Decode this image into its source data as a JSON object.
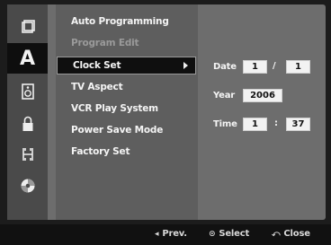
{
  "sidebar": {
    "icons": [
      {
        "name": "disc-setup-icon",
        "active": false
      },
      {
        "name": "language-icon",
        "letter": "A",
        "active": true
      },
      {
        "name": "speaker-icon",
        "active": false
      },
      {
        "name": "lock-icon",
        "active": false
      },
      {
        "name": "recording-icon",
        "active": false
      },
      {
        "name": "dvd-disc-icon",
        "active": false
      }
    ]
  },
  "menu": {
    "items": [
      {
        "label": "Auto Programming",
        "state": "normal"
      },
      {
        "label": "Program Edit",
        "state": "dim"
      },
      {
        "label": "Clock Set",
        "state": "selected"
      },
      {
        "label": "TV Aspect",
        "state": "normal"
      },
      {
        "label": "VCR Play System",
        "state": "normal"
      },
      {
        "label": "Power Save Mode",
        "state": "normal"
      },
      {
        "label": "Factory Set",
        "state": "normal"
      }
    ]
  },
  "clock": {
    "date_label": "Date",
    "date_month": "1",
    "date_sep": "/",
    "date_day": "1",
    "year_label": "Year",
    "year_value": "2006",
    "time_label": "Time",
    "time_hour": "1",
    "time_sep": ":",
    "time_minute": "37"
  },
  "footer": {
    "prev_icon": "◂",
    "prev_label": "Prev.",
    "select_icon": "⊙",
    "select_label": "Select",
    "close_icon": "⤺",
    "close_label": "Close"
  },
  "colors": {
    "panel": "#6d6d6d",
    "menu_bg": "#5e5e5e",
    "selected_bg": "#0f0f0f",
    "field_bg": "#f2f2f2"
  }
}
